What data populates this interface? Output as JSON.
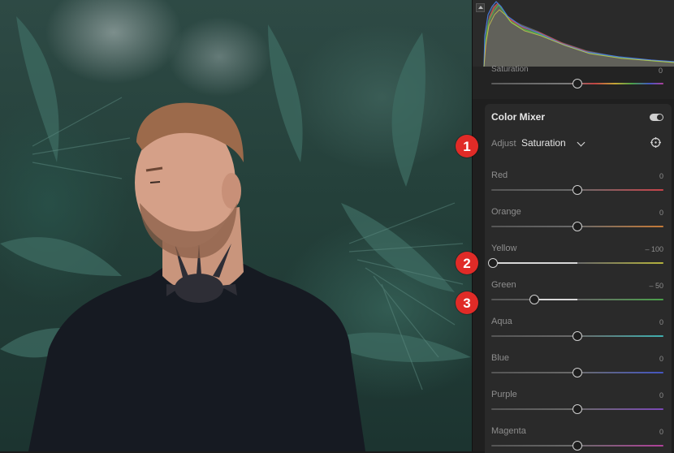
{
  "panel": {
    "histogram": {
      "icon": "clipping-triangle-icon"
    },
    "top_slider": {
      "label": "Saturation",
      "value": "0",
      "position": 0.5
    },
    "color_mixer": {
      "title": "Color Mixer",
      "toggle_on": true,
      "adjust_label": "Adjust",
      "adjust_value": "Saturation",
      "target_icon": "targeted-adjustment-icon",
      "sliders": [
        {
          "label": "Red",
          "value": "0",
          "position": 0.5,
          "track_color": "#c8434a"
        },
        {
          "label": "Orange",
          "value": "0",
          "position": 0.5,
          "track_color": "#c67a37"
        },
        {
          "label": "Yellow",
          "value": "– 100",
          "position": 0.0,
          "track_color": "#b5b33c"
        },
        {
          "label": "Green",
          "value": "– 50",
          "position": 0.25,
          "track_color": "#4aa04a"
        },
        {
          "label": "Aqua",
          "value": "0",
          "position": 0.5,
          "track_color": "#3fb0b0"
        },
        {
          "label": "Blue",
          "value": "0",
          "position": 0.5,
          "track_color": "#4456c2"
        },
        {
          "label": "Purple",
          "value": "0",
          "position": 0.5,
          "track_color": "#7b48b8"
        },
        {
          "label": "Magenta",
          "value": "0",
          "position": 0.5,
          "track_color": "#b0409a"
        }
      ]
    }
  },
  "callouts": [
    "1",
    "2",
    "3"
  ],
  "colors": {
    "callout": "#e02b27",
    "panel_bg": "#1f1f1f",
    "mixer_bg": "#2a2a2a"
  }
}
